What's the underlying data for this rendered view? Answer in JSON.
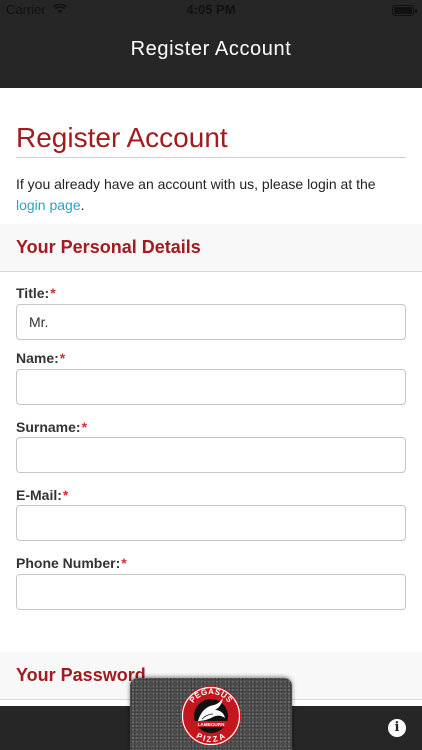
{
  "status_bar": {
    "carrier": "Carrier",
    "time": "4:05 PM"
  },
  "navbar": {
    "title": "Register Account"
  },
  "page": {
    "title": "Register Account",
    "intro_text": "If you already have an account with us, please login at the ",
    "intro_link": "login page",
    "intro_end": "."
  },
  "personal_section": {
    "title": "Your Personal Details",
    "fields": {
      "title_field": {
        "label": "Title:",
        "value": "Mr."
      },
      "name": {
        "label": "Name:",
        "value": ""
      },
      "surname": {
        "label": "Surname:",
        "value": ""
      },
      "email": {
        "label": "E-Mail:",
        "value": ""
      },
      "phone": {
        "label": "Phone Number:",
        "value": ""
      }
    },
    "required_mark": "*"
  },
  "password_section": {
    "title": "Your Password"
  },
  "logo": {
    "top_text": "PEGASUS",
    "middle_text": "LAMBOURN",
    "bottom_text": "PIZZA"
  },
  "bottom_bar": {
    "info_icon": "i"
  },
  "colors": {
    "accent": "#a01c1e",
    "link": "#2aa3c8",
    "bar": "#262626",
    "required": "#d32f2f"
  }
}
